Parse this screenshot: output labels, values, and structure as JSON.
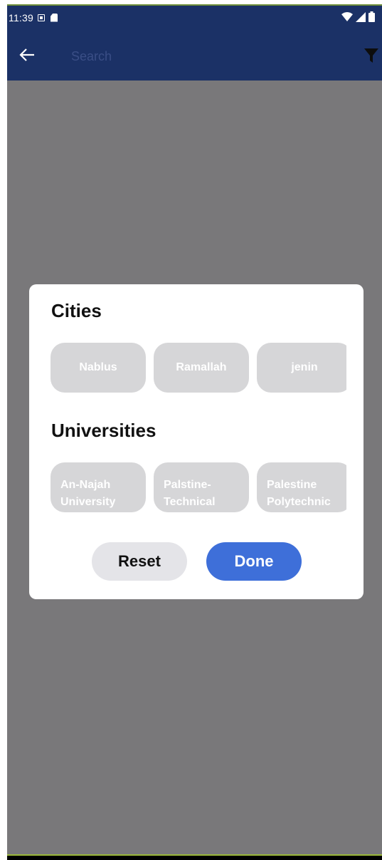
{
  "status_bar": {
    "time": "11:39",
    "icons": [
      "notification-icon",
      "sd-card-icon",
      "wifi-icon",
      "signal-icon",
      "battery-icon"
    ]
  },
  "app_bar": {
    "search_placeholder": "Search",
    "back_icon": "arrow-left-icon",
    "filter_icon": "filter-icon"
  },
  "dialog": {
    "cities": {
      "title": "Cities",
      "items": [
        "Nablus",
        "Ramallah",
        "jenin"
      ]
    },
    "universities": {
      "title": "Universities",
      "items": [
        "An-Najah University",
        "Palstine-Technical",
        "Palestine Polytechnic"
      ]
    },
    "reset_label": "Reset",
    "done_label": "Done"
  },
  "colors": {
    "app_bar": "#1b3166",
    "scrim": "#79787a",
    "chip": "#d6d6d8",
    "done": "#3e6fd9",
    "reset": "#e4e4e8"
  }
}
